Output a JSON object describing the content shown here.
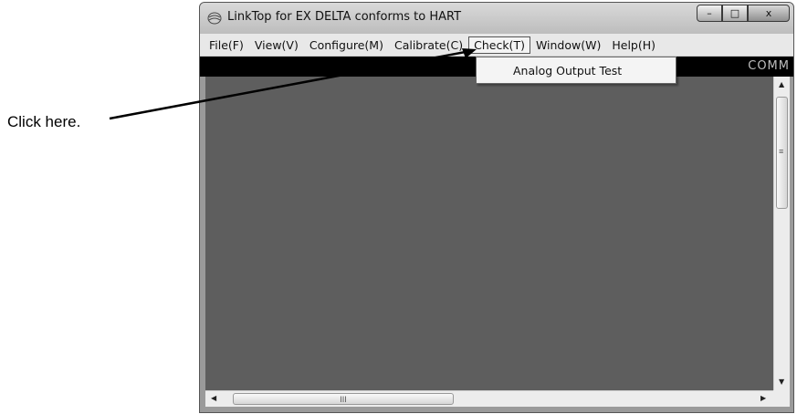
{
  "callout": {
    "text": "Click here."
  },
  "window": {
    "title": "LinkTop for EX DELTA conforms to HART",
    "caption_buttons": {
      "minimize": "–",
      "maximize": "□",
      "close": "x"
    }
  },
  "menubar": {
    "items": [
      {
        "label": "File(F)"
      },
      {
        "label": "View(V)"
      },
      {
        "label": "Configure(M)"
      },
      {
        "label": "Calibrate(C)"
      },
      {
        "label": "Check(T)"
      },
      {
        "label": "Window(W)"
      },
      {
        "label": "Help(H)"
      }
    ]
  },
  "status_strip": {
    "text": "COMM"
  },
  "dropdown": {
    "items": [
      {
        "label": "Analog Output Test"
      }
    ]
  },
  "scrollbars": {
    "h_grip": "III",
    "v_grip": "≡"
  }
}
